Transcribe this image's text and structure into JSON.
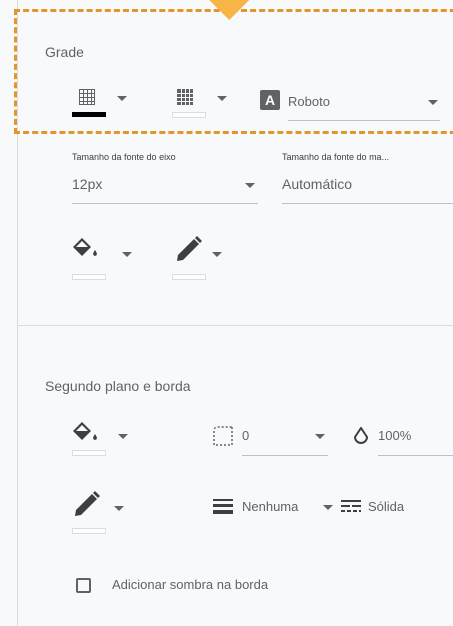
{
  "grid_section": {
    "title": "Grade",
    "font_button_letter": "A",
    "font_select_value": "Roboto"
  },
  "axis_font": {
    "axis_font_size_label": "Tamanho da fonte do eixo",
    "axis_font_size_value": "12px",
    "other_font_size_label": "Tamanho da fonte do ma...",
    "other_font_size_value": "Automático"
  },
  "background_section": {
    "title": "Segundo plano e borda",
    "radius_value": "0",
    "opacity_value": "100%",
    "border_weight_value": "Nenhuma",
    "border_style_value": "Sólida",
    "shadow_checkbox_label": "Adicionar sombra na borda"
  },
  "colors": {
    "accent_dashed": "#e0962a",
    "tab_orange": "#f7b547",
    "grid_line_color": "#000000"
  }
}
